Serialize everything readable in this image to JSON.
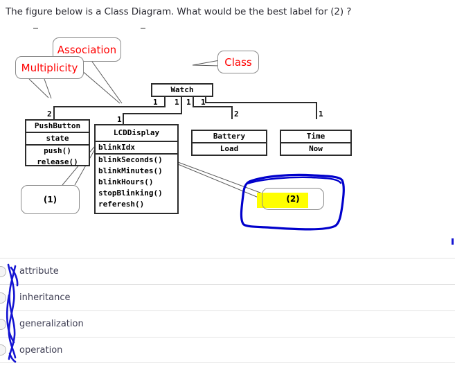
{
  "question": {
    "prompt": "The figure below is a Class Diagram. What would be the best label for (2) ?"
  },
  "figure": {
    "callouts": [
      {
        "id": "association",
        "label": "Association",
        "color": "#ff0000"
      },
      {
        "id": "class",
        "label": "Class",
        "color": "#ff0000"
      },
      {
        "id": "multiplicity",
        "label": "Multiplicity",
        "color": "#ff0000"
      },
      {
        "id": "answer-one",
        "label": "(1)",
        "color": "#000000"
      },
      {
        "id": "answer-two",
        "label": "(2)",
        "color": "#000000",
        "highlighted": true,
        "highlight_color": "#ffff00",
        "circled": true,
        "circle_color": "#0000cc"
      }
    ],
    "classes": [
      {
        "id": "watch",
        "name": "Watch",
        "attributes": [],
        "operations": []
      },
      {
        "id": "pushbutton",
        "name": "PushButton",
        "attributes": [
          "state"
        ],
        "operations": [
          "push()",
          "release()"
        ]
      },
      {
        "id": "lcddisplay",
        "name": "LCDDisplay",
        "attributes": [
          "blinkIdx"
        ],
        "operations": [
          "blinkSeconds()",
          "blinkMinutes()",
          "blinkHours()",
          "stopBlinking()",
          "referesh()"
        ]
      },
      {
        "id": "battery",
        "name": "Battery",
        "attributes": [
          "Load"
        ],
        "operations": []
      },
      {
        "id": "time",
        "name": "Time",
        "attributes": [
          "Now"
        ],
        "operations": []
      }
    ],
    "associations": [
      {
        "from": "watch",
        "to": "pushbutton",
        "from_multiplicity": "1",
        "to_multiplicity": "2"
      },
      {
        "from": "watch",
        "to": "lcddisplay",
        "from_multiplicity": "1",
        "to_multiplicity": "1"
      },
      {
        "from": "watch",
        "to": "battery",
        "from_multiplicity": "1",
        "to_multiplicity": "2"
      },
      {
        "from": "watch",
        "to": "time",
        "from_multiplicity": "1",
        "to_multiplicity": "1"
      }
    ]
  },
  "options": {
    "items": [
      {
        "label": "attribute",
        "selected": false
      },
      {
        "label": "inheritance",
        "selected": false
      },
      {
        "label": "generalization",
        "selected": false
      },
      {
        "label": "operation",
        "selected": false
      }
    ]
  },
  "annotation": {
    "ink_color": "#0000cc",
    "highlight_color": "#ffff00"
  }
}
